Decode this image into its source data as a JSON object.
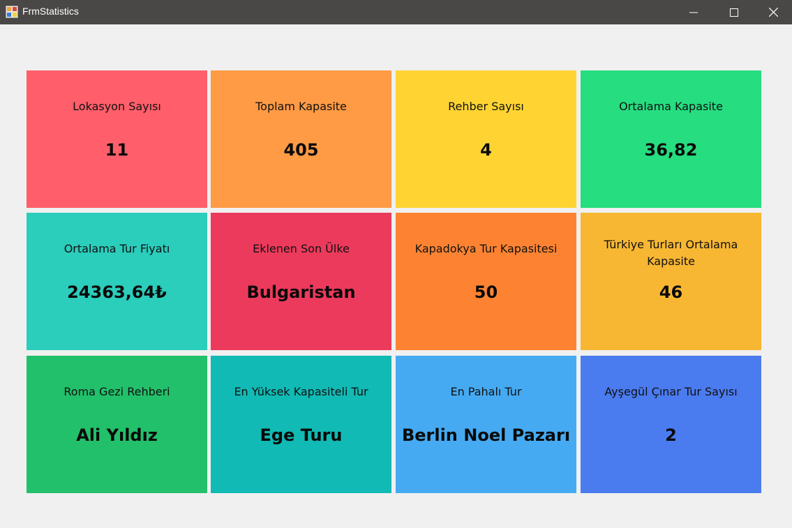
{
  "window": {
    "title": "FrmStatistics",
    "controls": {
      "minimize": "minimize-icon",
      "maximize": "maximize-icon",
      "close": "close-icon"
    }
  },
  "tiles": [
    {
      "label": "Lokasyon Sayısı",
      "value": "11",
      "color": "#ff5e6a"
    },
    {
      "label": "Toplam Kapasite",
      "value": "405",
      "color": "#ff9a45"
    },
    {
      "label": "Rehber Sayısı",
      "value": "4",
      "color": "#ffd432"
    },
    {
      "label": "Ortalama Kapasite",
      "value": "36,82",
      "color": "#26dd80"
    },
    {
      "label": "Ortalama Tur Fiyatı",
      "value": "24363,64₺",
      "color": "#2bcdbb"
    },
    {
      "label": "Eklenen Son Ülke",
      "value": "Bulgaristan",
      "color": "#ec3a5c"
    },
    {
      "label": "Kapadokya Tur Kapasitesi",
      "value": "50",
      "color": "#fd8332"
    },
    {
      "label": "Türkiye Turları Ortalama Kapasite",
      "value": "46",
      "color": "#f7b733"
    },
    {
      "label": "Roma Gezi Rehberi",
      "value": "Ali Yıldız",
      "color": "#22c06a"
    },
    {
      "label": "En Yüksek Kapasiteli Tur",
      "value": "Ege Turu",
      "color": "#11bab4"
    },
    {
      "label": "En Pahalı Tur",
      "value": "Berlin Noel Pazarı",
      "color": "#45aaf2"
    },
    {
      "label": "Ayşegül Çınar Tur Sayısı",
      "value": "2",
      "color": "#4a7bef"
    }
  ]
}
